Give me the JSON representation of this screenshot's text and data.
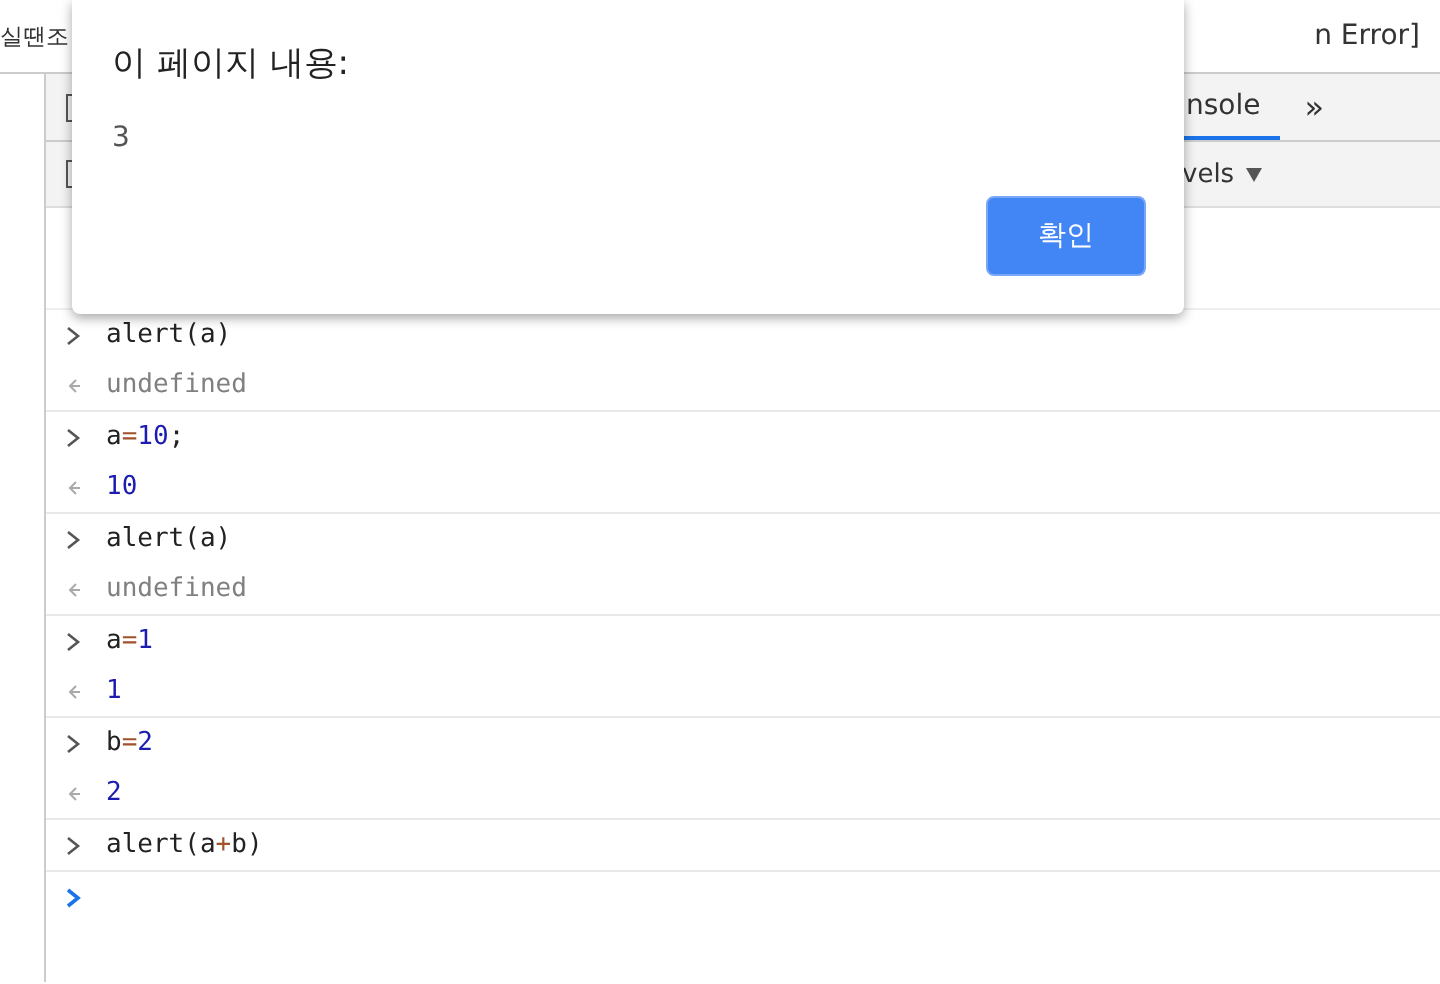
{
  "page": {
    "left_text": "실땐조",
    "right_text": "n Error]"
  },
  "devtools": {
    "tabs": [
      {
        "label": "nsole",
        "selected": true
      }
    ],
    "more_tabs": "»",
    "levels_label": "vels"
  },
  "console": {
    "entries": [
      {
        "input": [
          {
            "text": "alert(a)",
            "kind": "plain"
          }
        ],
        "output": {
          "text": "undefined",
          "kind": "undefined"
        }
      },
      {
        "input": [
          {
            "text": "a",
            "kind": "plain"
          },
          {
            "text": "=",
            "kind": "operator"
          },
          {
            "text": "10",
            "kind": "number"
          },
          {
            "text": ";",
            "kind": "plain"
          }
        ],
        "output": {
          "text": "10",
          "kind": "number"
        }
      },
      {
        "input": [
          {
            "text": "alert(a)",
            "kind": "plain"
          }
        ],
        "output": {
          "text": "undefined",
          "kind": "undefined"
        }
      },
      {
        "input": [
          {
            "text": "a",
            "kind": "plain"
          },
          {
            "text": "=",
            "kind": "operator"
          },
          {
            "text": "1",
            "kind": "number"
          }
        ],
        "output": {
          "text": "1",
          "kind": "number"
        }
      },
      {
        "input": [
          {
            "text": "b",
            "kind": "plain"
          },
          {
            "text": "=",
            "kind": "operator"
          },
          {
            "text": "2",
            "kind": "number"
          }
        ],
        "output": {
          "text": "2",
          "kind": "number"
        }
      },
      {
        "input": [
          {
            "text": "alert(a",
            "kind": "plain"
          },
          {
            "text": "+",
            "kind": "operator"
          },
          {
            "text": "b)",
            "kind": "plain"
          }
        ]
      }
    ]
  },
  "dialog": {
    "title": "이 페이지 내용:",
    "message": "3",
    "button": "확인"
  }
}
